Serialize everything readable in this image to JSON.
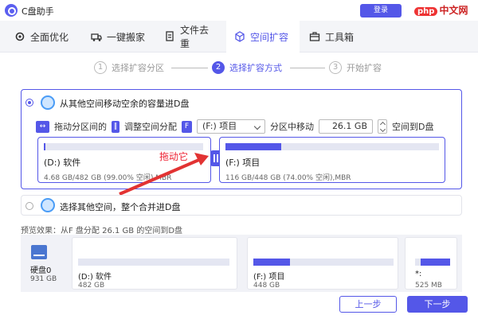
{
  "app": {
    "title": "C盘助手",
    "login_label": "登录",
    "watermark_badge": "php",
    "watermark_text": "中文网"
  },
  "tabs": [
    {
      "label": "全面优化",
      "icon": "gear-icon"
    },
    {
      "label": "一键搬家",
      "icon": "truck-icon"
    },
    {
      "label": "文件去重",
      "icon": "file-copy-icon"
    },
    {
      "label": "空间扩容",
      "icon": "expand-icon",
      "active": true
    },
    {
      "label": "工具箱",
      "icon": "toolbox-icon"
    }
  ],
  "steps": [
    {
      "num": "1",
      "label": "选择扩容分区"
    },
    {
      "num": "2",
      "label": "选择扩容方式",
      "active": true
    },
    {
      "num": "3",
      "label": "开始扩容"
    }
  ],
  "option1": {
    "label": "从其他空间移动空余的容量进D盘",
    "drag_label": "拖动分区间的",
    "adjust_label": "调整空间分配",
    "select_value": "(F:) 项目",
    "move_label": "分区中移动",
    "amount": "26.1 GB",
    "to_label": "空间到D盘",
    "left_partition": {
      "name": "(D:) 软件",
      "info": "4.68 GB/482 GB (99.00% 空闲),MBR",
      "fill": 0.01
    },
    "right_partition": {
      "name": "(F:) 项目",
      "info": "116 GB/448 GB (74.00% 空闲),MBR",
      "fill": 0.26
    },
    "annotation": "拖动它"
  },
  "option2": {
    "label": "选择其他空间，整个合并进D盘"
  },
  "preview": {
    "title": "预览效果：从F 盘分配 26.1 GB 的空间到D盘",
    "disk": {
      "name": "硬盘0",
      "size": "931 GB"
    },
    "partitions": [
      {
        "name": "(D:) 软件",
        "size": "482 GB",
        "fill": 0.0
      },
      {
        "name": "(F:) 项目",
        "size": "448 GB",
        "fill": 0.26
      },
      {
        "name": "*:",
        "size": "525 MB",
        "fill": 0.85
      }
    ]
  },
  "buttons": {
    "prev": "上一步",
    "next": "下一步"
  },
  "colors": {
    "accent": "#5457e8",
    "annotation": "#e23333"
  }
}
